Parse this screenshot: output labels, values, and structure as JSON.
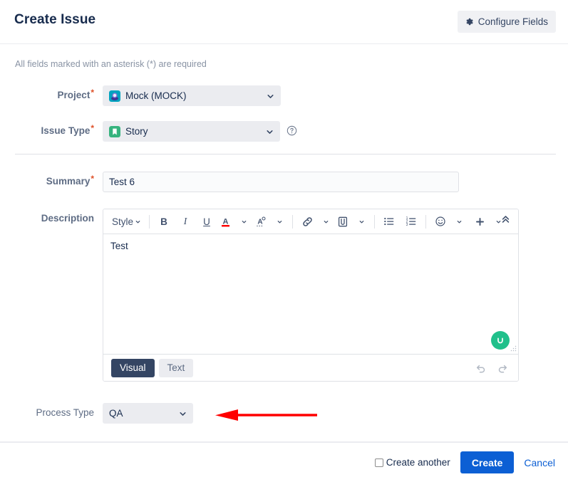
{
  "header": {
    "title": "Create Issue",
    "configure_fields_label": "Configure Fields"
  },
  "required_note": "All fields marked with an asterisk (*) are required",
  "fields": {
    "project": {
      "label": "Project",
      "required_mark": "*",
      "value": "Mock (MOCK)"
    },
    "issue_type": {
      "label": "Issue Type",
      "required_mark": "*",
      "value": "Story"
    },
    "summary": {
      "label": "Summary",
      "required_mark": "*",
      "value": "Test 6",
      "placeholder": ""
    },
    "description": {
      "label": "Description",
      "body_text": "Test",
      "toolbar": {
        "style_label": "Style",
        "bold_label": "B",
        "italic_label": "I",
        "underline_label": "U",
        "text_color_label": "A",
        "highlight_label": "A"
      },
      "modes": [
        {
          "label": "Visual",
          "active": true
        },
        {
          "label": "Text",
          "active": false
        }
      ]
    },
    "process_type": {
      "label": "Process Type",
      "value": "QA"
    }
  },
  "footer": {
    "create_another_label": "Create another",
    "create_another_checked": false,
    "create_label": "Create",
    "cancel_label": "Cancel"
  },
  "colors": {
    "accent_blue": "#0c5fd4",
    "required_star": "#de5028",
    "dropdown_bg": "#ebecf0",
    "label_text": "#5e6c84",
    "title_text": "#172b4d",
    "annotation_arrow": "#ff0000",
    "chat_bubble": "#21c08b",
    "project_icon": "#00a3bf",
    "story_icon": "#36b37e",
    "active_tab_bg": "#344563"
  }
}
